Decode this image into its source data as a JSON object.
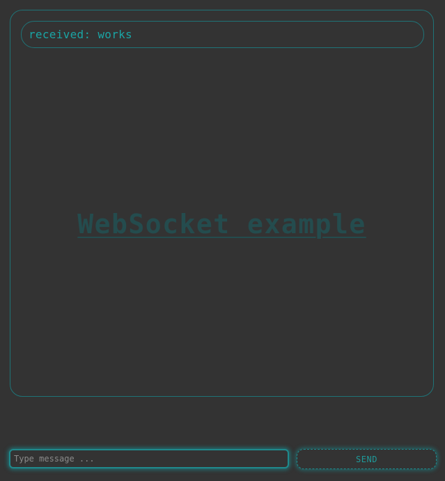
{
  "messages": [
    {
      "text": "received: works"
    }
  ],
  "background_title": "WebSocket example",
  "composer": {
    "placeholder": "Type message ...",
    "value": "",
    "send_label": "SEND"
  },
  "colors": {
    "background": "#333333",
    "accent": "#1aa5a5",
    "border": "#1f7478",
    "title_faded": "#244c4e"
  }
}
